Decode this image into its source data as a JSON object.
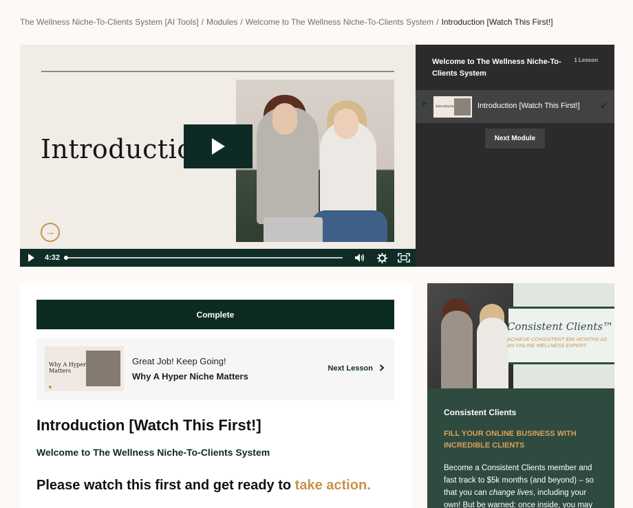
{
  "breadcrumb": {
    "items": [
      "The Wellness Niche-To-Clients System [AI Tools]",
      "Modules",
      "Welcome to The Wellness Niche-To-Clients System"
    ],
    "current": "Introduction [Watch This First!]",
    "separator": "/"
  },
  "video": {
    "title_text": "Introduction",
    "time": "4:32",
    "progress": 0,
    "icons": [
      "play-icon",
      "volume-icon",
      "settings-icon",
      "fullscreen-icon"
    ]
  },
  "playlist": {
    "module_title": "Welcome to The Wellness Niche-To-Clients System",
    "lesson_count": "1 Lesson",
    "lesson": {
      "title": "Introduction [Watch This First!]",
      "thumb_text": "Introduction",
      "completed": true
    },
    "next_module_label": "Next Module"
  },
  "lesson": {
    "complete_label": "Complete",
    "next": {
      "encouragement": "Great Job! Keep Going!",
      "title": "Why A Hyper Niche Matters",
      "thumb_text": "Why A Hyper Niche Matters",
      "link_label": "Next Lesson"
    },
    "heading": "Introduction [Watch This First!]",
    "subheading": "Welcome to The Wellness Niche-To-Clients System",
    "callout": {
      "text": "Please watch this first and get ready to ",
      "accent": "take action."
    }
  },
  "ad": {
    "banner_title": "Consistent Clients™",
    "banner_subtitle": "ACHIEVE CONSISTENT $5K MONTHS AS AN ONLINE WELLNESS EXPERT",
    "title": "Consistent Clients",
    "subtitle": "FILL YOUR ONLINE BUSINESS WITH INCREDIBLE CLIENTS",
    "body_1": "Become a Consistent Clients member and fast track to $5k months (and beyond) – so that you can ",
    "body_em": "change lives",
    "body_2": ", including your own! But be warned: once inside, you may"
  },
  "colors": {
    "brand_dark": "#0c2b23",
    "accent": "#c9924f",
    "ad_green": "#2f4a3f",
    "sidebar_dark": "#2b2b2b"
  }
}
